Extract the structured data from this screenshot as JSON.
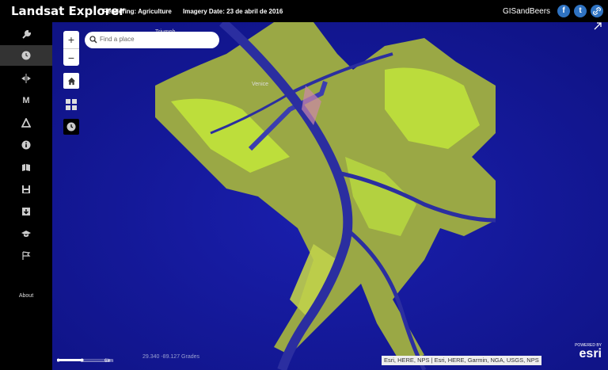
{
  "header": {
    "app_title": "Landsat Explorer",
    "rendering": "Rendering: Agriculture",
    "imagery_date": "Imagery Date: 23 de abril de 2016",
    "user": "GISandBeers"
  },
  "social": {
    "facebook": "f",
    "twitter": "t",
    "link": "🔗"
  },
  "sidebar": {
    "items": [
      {
        "icon": "wrench-icon"
      },
      {
        "icon": "clock-icon"
      },
      {
        "icon": "swipe-icon"
      },
      {
        "icon": "m-icon",
        "label": "M"
      },
      {
        "icon": "triangle-icon"
      },
      {
        "icon": "info-icon"
      },
      {
        "icon": "bookmark-icon"
      },
      {
        "icon": "save-icon"
      },
      {
        "icon": "download-icon"
      },
      {
        "icon": "graduation-cap-icon"
      },
      {
        "icon": "flag-icon"
      }
    ],
    "about": "About"
  },
  "map": {
    "search_placeholder": "Find a place",
    "zoom_in": "+",
    "zoom_out": "−",
    "label_venice": "Venice",
    "label_triumph": "Triumph",
    "scale_labels": [
      "0",
      "3",
      "6km"
    ],
    "coords": "29.340   -89.127 Grades",
    "attribution": "Esri, HERE, NPS | Esri, HERE, Garmin, NGA, USGS, NPS",
    "powered_by": "POWERED BY",
    "esri": "esri"
  },
  "colors": {
    "water": "#14179a",
    "land": "#a9b54a",
    "vegetation": "#c3e83a",
    "river": "#3b3db0"
  }
}
